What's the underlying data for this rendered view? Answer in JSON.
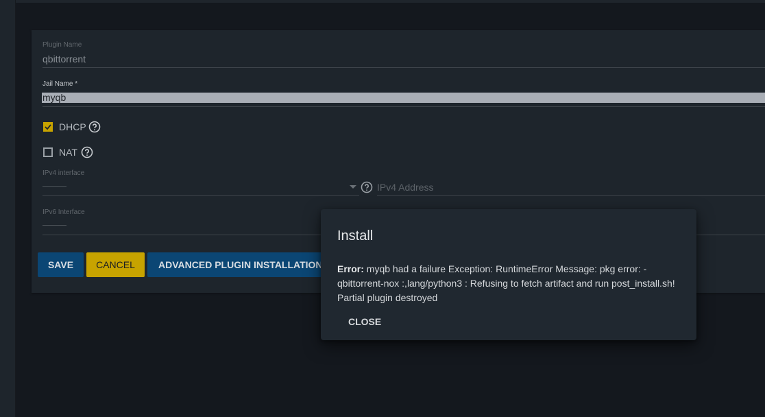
{
  "form": {
    "plugin_name": {
      "label": "Plugin Name",
      "value": "qbittorrent"
    },
    "jail_name": {
      "label": "Jail Name *",
      "value": "myqb"
    },
    "dhcp": {
      "label": "DHCP",
      "checked": true
    },
    "nat": {
      "label": "NAT",
      "checked": false
    },
    "ipv4_interface": {
      "label": "IPv4 interface",
      "value": "——"
    },
    "ipv4_address": {
      "placeholder": "IPv4 Address"
    },
    "ipv6_interface": {
      "label": "IPv6 Interface",
      "value": "——"
    }
  },
  "buttons": {
    "save": "SAVE",
    "cancel": "CANCEL",
    "advanced": "ADVANCED PLUGIN INSTALLATION"
  },
  "dialog": {
    "title": "Install",
    "error_label": "Error:",
    "message": " myqb had a failure Exception: RuntimeError Message: pkg error: - qbittorrent-nox :,lang/python3 : Refusing to fetch artifact and run post_install.sh! Partial plugin destroyed",
    "close": "CLOSE"
  },
  "colors": {
    "accent_yellow": "#c7a300",
    "primary_blue": "#0b4674",
    "dialog_bg": "#202830"
  },
  "icons": {
    "help": "help-circle-icon",
    "check": "check-icon",
    "dropdown": "dropdown-arrow-icon"
  }
}
